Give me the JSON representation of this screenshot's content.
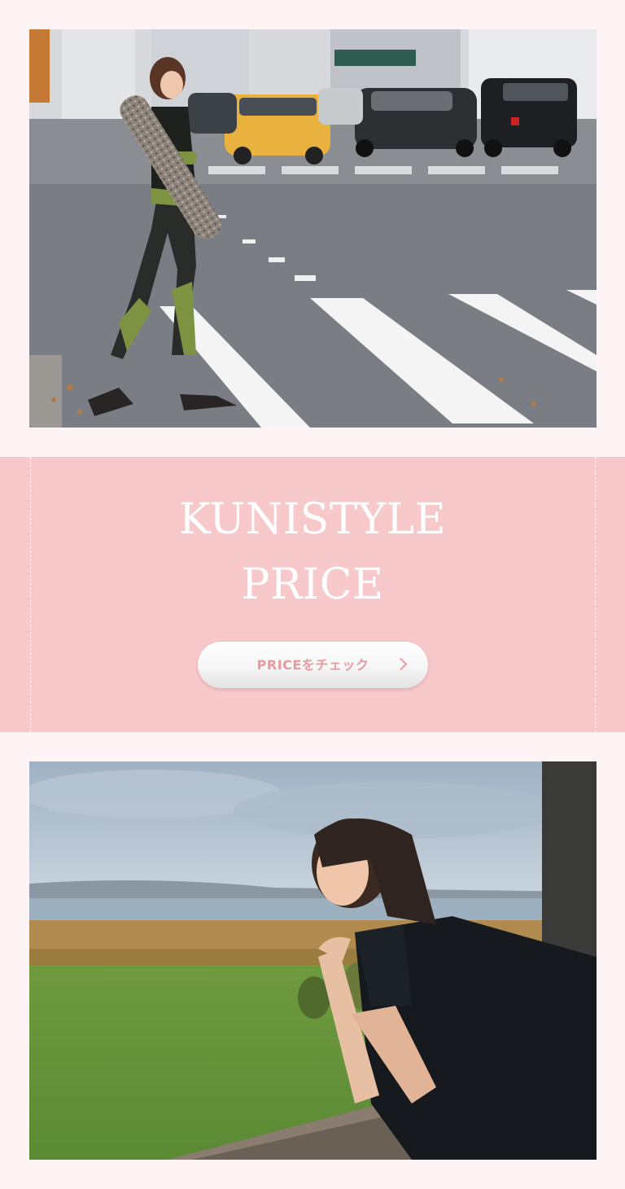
{
  "photos": {
    "street": {
      "icon": "photo-street-crossing",
      "alt": ""
    },
    "lakeside": {
      "icon": "photo-lakeside-portrait",
      "alt": ""
    }
  },
  "price_section": {
    "title_line_1": "KUNISTYLE",
    "title_line_2": "PRICE",
    "button_label": "PRICEをチェック",
    "button_icon": "chevron-right-icon"
  },
  "colors": {
    "page_background": "#fff4f5",
    "band_background": "#f8c9cb",
    "button_text": "#e89aa0",
    "title_text": "#ffffff"
  }
}
